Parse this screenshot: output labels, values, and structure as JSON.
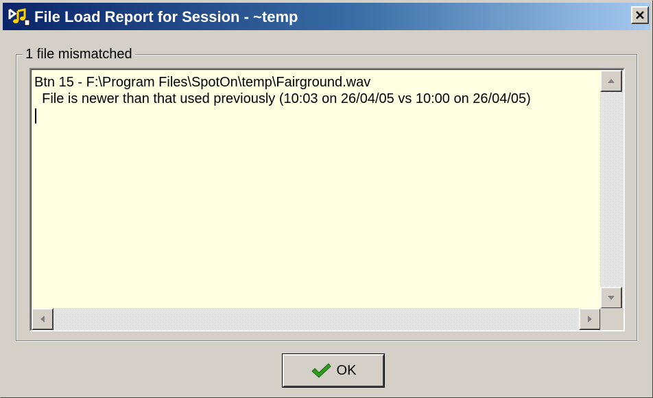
{
  "window": {
    "title": "File Load Report for Session - ~temp"
  },
  "group": {
    "label": "1 file mismatched"
  },
  "report": {
    "lines": [
      "Btn 15 - F:\\Program Files\\SpotOn\\temp\\Fairground.wav",
      "  File is newer than that used previously (10:03 on 26/04/05 vs 10:00 on 26/04/05)"
    ]
  },
  "buttons": {
    "ok_label": "OK"
  },
  "icons": {
    "app": "music-note-app-icon",
    "close": "close-icon",
    "ok": "green-checkmark-icon",
    "scroll_up": "arrow-up-icon",
    "scroll_down": "arrow-down-icon",
    "scroll_left": "arrow-left-icon",
    "scroll_right": "arrow-right-icon"
  },
  "colors": {
    "titlebar_start": "#0a246a",
    "titlebar_end": "#a6caf0",
    "memo_background": "#ffffe1",
    "face": "#d4d0c8",
    "check": "#2e9a1c"
  }
}
